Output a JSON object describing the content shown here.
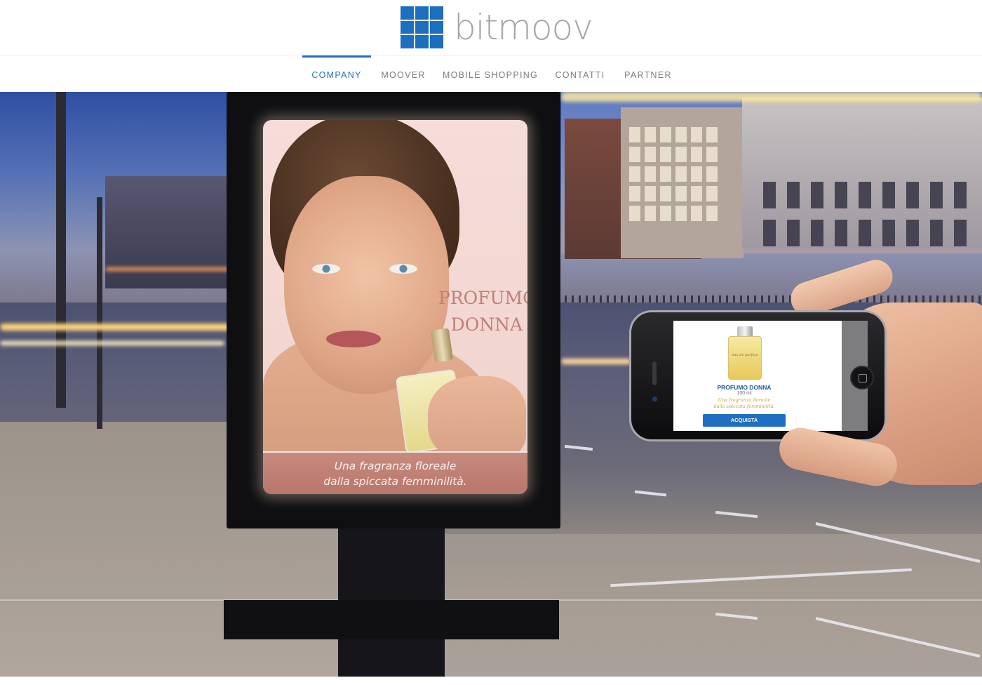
{
  "brand": {
    "logo_text": "bitmoov",
    "logo_color": "#1c6fbf",
    "logo_text_color": "#a6a6a6"
  },
  "nav": {
    "active_color": "#1f73c4",
    "items": [
      {
        "label": "COMPANY",
        "active": true
      },
      {
        "label": "MOOVER",
        "active": false
      },
      {
        "label": "MOBILE SHOPPING",
        "active": false
      },
      {
        "label": "CONTATTI",
        "active": false
      },
      {
        "label": "PARTNER",
        "active": false
      }
    ]
  },
  "hero": {
    "poster": {
      "title_line1": "PROFUMO",
      "title_line2": "DONNA",
      "tagline_line1": "Una fragranza floreale",
      "tagline_line2": "dalla spiccata femminilità."
    },
    "phone_app": {
      "bottle_label": "eau de parfum",
      "product_name": "PROFUMO DONNA",
      "size": "100 ml",
      "description_line1": "Una fragranza floreale",
      "description_line2": "dalla spiccata femminilità.",
      "buy_label": "ACQUISTA",
      "buy_color": "#1f6ec0"
    }
  }
}
